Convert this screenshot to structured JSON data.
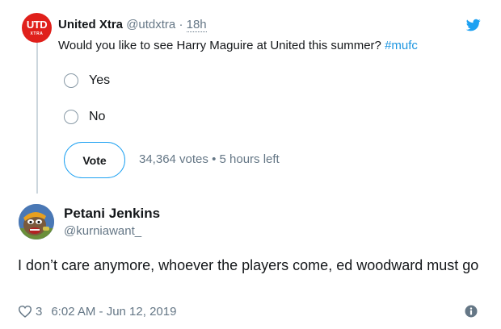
{
  "parent_tweet": {
    "logo": {
      "line1": "UTD",
      "line2": "XTRA",
      "color": "#e0201b"
    },
    "display_name": "United Xtra",
    "handle": "@utdxtra",
    "separator": "·",
    "time_ago": "18h",
    "text": "Would you like to see Harry Maguire at United this summer? ",
    "hashtag": "#mufc",
    "brand_icon": "twitter-bird-icon",
    "poll": {
      "options": [
        {
          "label": "Yes"
        },
        {
          "label": "No"
        }
      ],
      "vote_label": "Vote",
      "votes": "34,364 votes",
      "meta_separator": "•",
      "time_left": "5 hours left"
    }
  },
  "reply_tweet": {
    "avatar_icon": "cartoon-avatar",
    "display_name": "Petani Jenkins",
    "handle": "@kurniawant_",
    "text": "I don’t care anymore, whoever the players come, ed woodward must go",
    "like_icon": "heart-icon",
    "like_count": "3",
    "timestamp": "6:02 AM - Jun 12, 2019",
    "info_icon": "info-icon"
  },
  "colors": {
    "link_blue": "#1b95e0",
    "accent_blue": "#1da1f2",
    "secondary_text": "#657786",
    "primary_text": "#14171a"
  }
}
